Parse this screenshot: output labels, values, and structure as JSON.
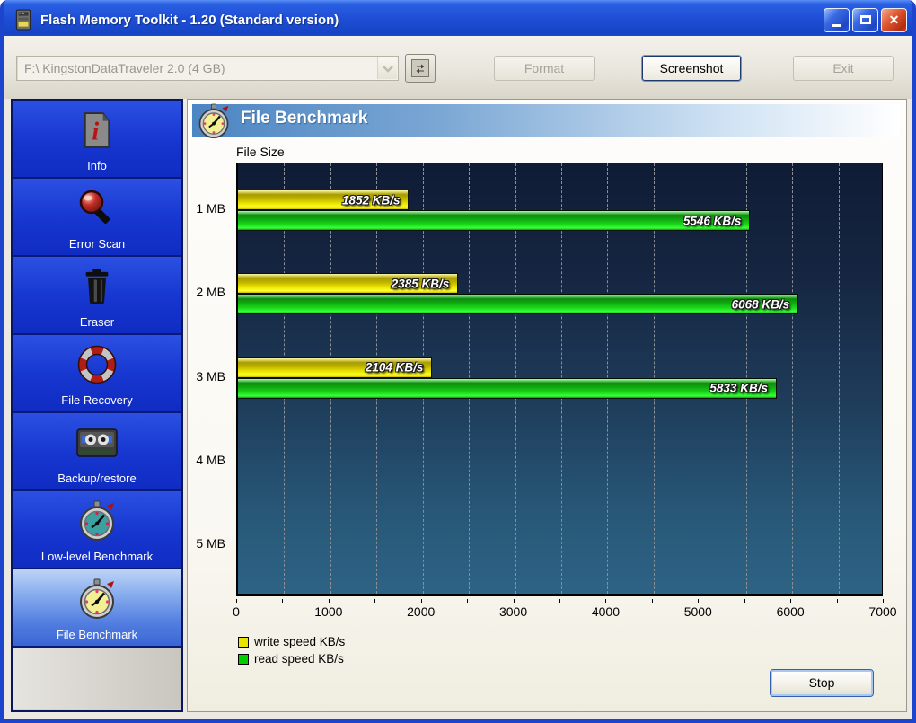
{
  "window": {
    "title": "Flash Memory Toolkit - 1.20 (Standard version)",
    "controls": {
      "minimize": "minimize",
      "maximize": "maximize",
      "close": "close"
    }
  },
  "toolbar": {
    "device_selector_value": "F:\\ KingstonDataTraveler 2.0 (4 GB)",
    "format_label": "Format",
    "screenshot_label": "Screenshot",
    "exit_label": "Exit"
  },
  "sidebar": {
    "items": [
      {
        "label": "Info",
        "icon": "info-document-icon",
        "selected": false
      },
      {
        "label": "Error Scan",
        "icon": "magnifier-icon",
        "selected": false
      },
      {
        "label": "Eraser",
        "icon": "trash-icon",
        "selected": false
      },
      {
        "label": "File Recovery",
        "icon": "lifebuoy-icon",
        "selected": false
      },
      {
        "label": "Backup/restore",
        "icon": "cassette-icon",
        "selected": false
      },
      {
        "label": "Low-level Benchmark",
        "icon": "stopwatch-teal-icon",
        "selected": false
      },
      {
        "label": "File Benchmark",
        "icon": "stopwatch-yellow-icon",
        "selected": true
      }
    ]
  },
  "main": {
    "header_title": "File Benchmark",
    "stop_label": "Stop"
  },
  "chart_data": {
    "type": "bar",
    "orientation": "horizontal",
    "title": "File Size",
    "categories": [
      "1 MB",
      "2 MB",
      "3 MB",
      "4 MB",
      "5 MB"
    ],
    "series": [
      {
        "name": "write speed KB/s",
        "color": "#e8e400",
        "values": [
          1852,
          2385,
          2104,
          null,
          null
        ]
      },
      {
        "name": "read speed KB/s",
        "color": "#00cc00",
        "values": [
          5546,
          6068,
          5833,
          null,
          null
        ]
      }
    ],
    "value_unit": "KB/s",
    "xlim": [
      0,
      7000
    ],
    "xticks": [
      0,
      1000,
      2000,
      3000,
      4000,
      5000,
      6000,
      7000
    ],
    "minor_tick_step": 500,
    "gridline_step": 500,
    "grid": true,
    "legend_position": "bottom-left",
    "plot_bg_top": "#101c36",
    "plot_bg_bottom": "#2d6385"
  }
}
